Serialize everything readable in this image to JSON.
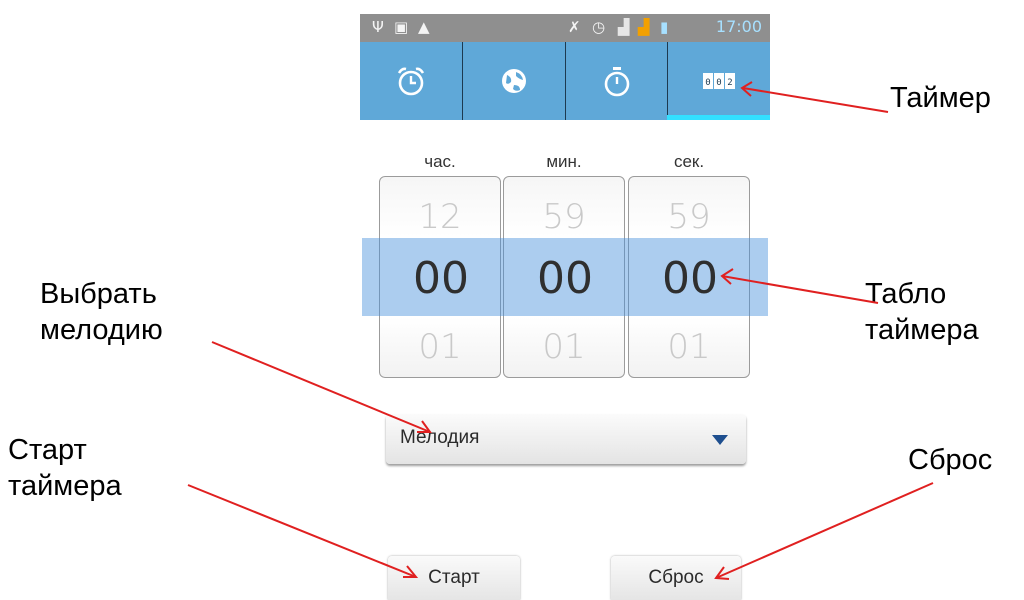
{
  "status_bar": {
    "time": "17:00",
    "left_icons": [
      "usb-icon",
      "image-icon",
      "warning-icon"
    ],
    "right_icons": [
      "mute-icon",
      "alarm-icon",
      "signal-icon",
      "signal-2-icon",
      "battery-icon"
    ]
  },
  "tabs": [
    {
      "icon": "alarm-clock-icon",
      "active": false
    },
    {
      "icon": "world-clock-icon",
      "active": false
    },
    {
      "icon": "stopwatch-icon",
      "active": false
    },
    {
      "icon": "timer-icon",
      "label": "002",
      "active": true
    }
  ],
  "timer": {
    "columns": [
      {
        "header": "час.",
        "prev": "12",
        "value": "00",
        "next": "01"
      },
      {
        "header": "мин.",
        "prev": "59",
        "value": "00",
        "next": "01"
      },
      {
        "header": "сек.",
        "prev": "59",
        "value": "00",
        "next": "01"
      }
    ]
  },
  "melody_select": {
    "value": "Мелодия"
  },
  "buttons": {
    "start": "Старт",
    "reset": "Сброс"
  },
  "annotations": {
    "timer_tab": "Таймер",
    "timer_display": "Табло таймера",
    "choose_melody": "Выбрать мелодию",
    "start_timer": "Старт таймера",
    "reset": "Сброс"
  },
  "colors": {
    "tab_bar": "#5fa8d8",
    "selection_band": "#4691dc",
    "arrow": "#e02020",
    "active_tab_indicator": "#33e0ff"
  }
}
